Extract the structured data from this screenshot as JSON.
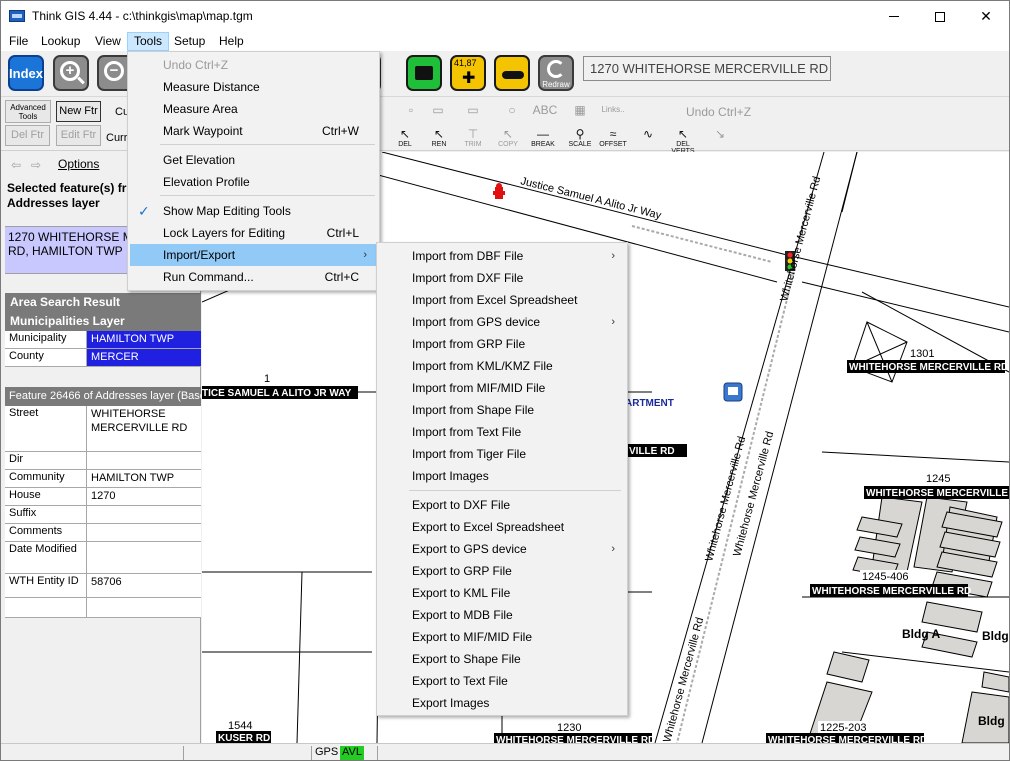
{
  "window": {
    "title": "Think GIS 4.44 - c:\\thinkgis\\map\\map.tgm"
  },
  "menubar": {
    "file": "File",
    "lookup": "Lookup",
    "view": "View",
    "tools": "Tools",
    "setup": "Setup",
    "help": "Help"
  },
  "toolbar": {
    "index": "Index",
    "gps_label": "41,87",
    "redraw_label": "Redraw",
    "address_box": "1270 WHITEHORSE MERCERVILLE RD"
  },
  "edit_toolbar": {
    "advanced_tools": "Advanced Tools",
    "new_ftr": "New Ftr",
    "del_ftr": "Del Ftr",
    "edit_ftr": "Edit Ftr",
    "cur_label_1": "Cu",
    "cur_label_2": "Curr",
    "undo": "Undo  Ctrl+Z",
    "tools": [
      {
        "label": "",
        "glyph": "▫"
      },
      {
        "label": "",
        "glyph": "▭"
      },
      {
        "label": "",
        "glyph": "▭"
      },
      {
        "label": "",
        "glyph": "○"
      },
      {
        "label": "",
        "glyph": "ABC"
      },
      {
        "label": "",
        "glyph": "▦"
      },
      {
        "label": "",
        "glyph": "Links.."
      },
      {
        "label": "DEL",
        "glyph": "↖"
      },
      {
        "label": "REN",
        "glyph": "↖"
      },
      {
        "label": "TRIM",
        "glyph": "⊤"
      },
      {
        "label": "COPY",
        "glyph": "↖"
      },
      {
        "label": "BREAK",
        "glyph": "—"
      },
      {
        "label": "SCALE",
        "glyph": "⚲"
      },
      {
        "label": "OFFSET",
        "glyph": "≈"
      },
      {
        "label": "",
        "glyph": "∿"
      },
      {
        "label": "DEL VERTS",
        "glyph": "↖"
      },
      {
        "label": "",
        "glyph": "↘"
      }
    ]
  },
  "options_link": "Options",
  "left_panel": {
    "selected_title": "Selected feature(s) fr",
    "selected_layer": "Addresses layer",
    "selected_line1": "1270 WHITEHORSE ME",
    "selected_line2": "RD, HAMILTON TWP",
    "area_search_title": "Area Search Result",
    "area_search_layer": "Municipalities Layer",
    "area_rows": [
      {
        "key": "Municipality",
        "value": "HAMILTON TWP"
      },
      {
        "key": "County",
        "value": "MERCER"
      }
    ],
    "feature_title": "Feature 26466 of Addresses layer  (Base",
    "feature_rows": [
      {
        "key": "Street",
        "value": "WHITEHORSE MERCERVILLE RD"
      },
      {
        "key": "Dir",
        "value": ""
      },
      {
        "key": "Community",
        "value": "HAMILTON TWP"
      },
      {
        "key": "House",
        "value": "1270"
      },
      {
        "key": "Suffix",
        "value": ""
      },
      {
        "key": "Comments",
        "value": ""
      },
      {
        "key": "Date Modified",
        "value": ""
      },
      {
        "key": "WTH Entity ID",
        "value": "58706"
      }
    ]
  },
  "map": {
    "labels": {
      "justice_street": "Justice Samuel A Alito Jr Way",
      "justice_label": "TICE SAMUEL A ALITO JR WAY",
      "whitehorse_road_1": "Whitehorse Mercerville Rd",
      "whitehorse_road_2": "Whitehorse Mercerville Rd",
      "whitehorse_road_3": "Whitehorse Mercerville Rd",
      "whitehorse_road_4": "Whitehorse Mercerville Rd",
      "num_1": "1",
      "num_1301": "1301",
      "whm_1301": "WHITEHORSE MERCERVILLE RD",
      "num_1245": "1245",
      "whm_1245": "WHITEHORSE MERCERVILLE RD",
      "num_1245_406": "1245-406",
      "whm_1245_406": "WHITEHORSE MERCERVILLE RD",
      "bldg_a": "Bldg A",
      "bldg_2": "Bldg",
      "bldg_3": "Bldg",
      "artment": "ARTMENT",
      "ville_rd": "VILLE RD",
      "num_1544": "1544",
      "kuser": "KUSER RD",
      "num_1230": "1230",
      "whm_1230": "WHITEHORSE MERCERVILLE RD",
      "num_1225": "1225-203",
      "whm_1225": "WHITEHORSE MERCERVILLE RD"
    }
  },
  "status": {
    "gps": "GPS",
    "avl": "AVL"
  },
  "tools_menu": {
    "items": [
      {
        "label": "Undo  Ctrl+Z",
        "shortcut": "",
        "disabled": true
      },
      {
        "label": "Measure Distance",
        "shortcut": ""
      },
      {
        "label": "Measure Area",
        "shortcut": ""
      },
      {
        "label": "Mark Waypoint",
        "shortcut": "Ctrl+W"
      },
      {
        "label": "Get Elevation",
        "shortcut": ""
      },
      {
        "label": "Elevation Profile",
        "shortcut": ""
      },
      {
        "label": "Show Map Editing Tools",
        "shortcut": "",
        "checked": true
      },
      {
        "label": "Lock Layers for Editing",
        "shortcut": "Ctrl+L"
      },
      {
        "label": "Import/Export",
        "shortcut": "",
        "submenu": true,
        "highlighted": true
      },
      {
        "label": "Run Command...",
        "shortcut": "Ctrl+C"
      }
    ]
  },
  "import_export_menu": {
    "items": [
      {
        "label": "Import from DBF File",
        "submenu": true
      },
      {
        "label": "Import from DXF File"
      },
      {
        "label": "Import from Excel Spreadsheet"
      },
      {
        "label": "Import from GPS device",
        "submenu": true
      },
      {
        "label": "Import from GRP File"
      },
      {
        "label": "Import from KML/KMZ File"
      },
      {
        "label": "Import from MIF/MID File"
      },
      {
        "label": "Import from Shape File"
      },
      {
        "label": "Import from Text File"
      },
      {
        "label": "Import from Tiger File"
      },
      {
        "label": "Import Images"
      },
      {
        "label": "Export to DXF File"
      },
      {
        "label": "Export to Excel Spreadsheet"
      },
      {
        "label": "Export to GPS device",
        "submenu": true
      },
      {
        "label": "Export to GRP File"
      },
      {
        "label": "Export to KML File"
      },
      {
        "label": "Export to MDB File"
      },
      {
        "label": "Export to MIF/MID File"
      },
      {
        "label": "Export to Shape File"
      },
      {
        "label": "Export to Text File"
      },
      {
        "label": "Export Images"
      }
    ]
  },
  "colors": {
    "menu_highlight": "#91c9f7",
    "selection_row": "#c8c8ff",
    "value_highlight": "#2020e0",
    "avl_green": "#22cc22",
    "index_blue": "#1b74d8"
  }
}
